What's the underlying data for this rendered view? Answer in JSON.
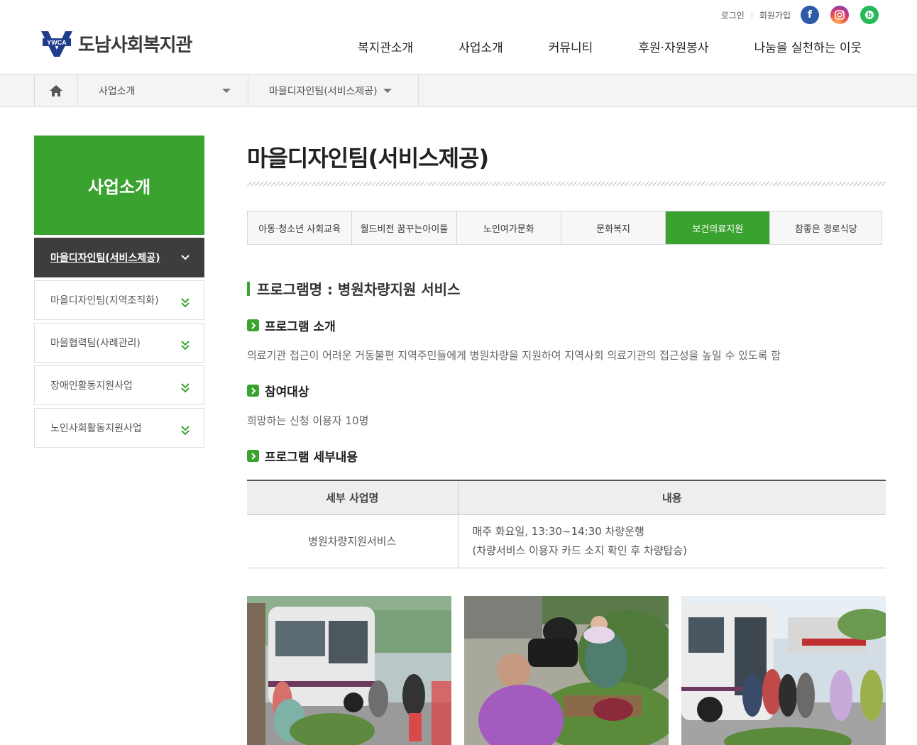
{
  "header": {
    "logo_badge": "YWCA",
    "logo_text": "도남사회복지관",
    "util": {
      "login": "로그인",
      "join": "회원가입"
    },
    "sns": [
      "facebook-icon",
      "instagram-icon",
      "blog-icon"
    ],
    "gnb": [
      "복지관소개",
      "사업소개",
      "커뮤니티",
      "후원·자원봉사",
      "나눔을 실천하는 이웃"
    ]
  },
  "location": {
    "depth1": "사업소개",
    "depth2": "마을디자인팀(서비스제공)"
  },
  "sidebar": {
    "title": "사업소개",
    "items": [
      {
        "label": "마을디자인팀(서비스제공)",
        "active": true
      },
      {
        "label": "마을디자인팀(지역조직화)",
        "active": false
      },
      {
        "label": "마을협력팀(사례관리)",
        "active": false
      },
      {
        "label": "장애인활동지원사업",
        "active": false
      },
      {
        "label": "노인사회활동지원사업",
        "active": false
      }
    ]
  },
  "main": {
    "title": "마을디자인팀(서비스제공)",
    "tabs": [
      {
        "label": "아동·청소년 사회교육",
        "active": false
      },
      {
        "label": "월드비전 꿈꾸는아이들",
        "active": false
      },
      {
        "label": "노인여가문화",
        "active": false
      },
      {
        "label": "문화복지",
        "active": false
      },
      {
        "label": "보건의료지원",
        "active": true
      },
      {
        "label": "참좋은 경로식당",
        "active": false
      }
    ],
    "program_title": "프로그램명 : 병원차량지원 서비스",
    "intro_heading": "프로그램 소개",
    "intro_text": "의료기관 접근이 어려운 거동불편 지역주민들에게 병원차량을 지원하여 지역사회 의료기관의 접근성을 높일 수 있도록 함",
    "target_heading": "참여대상",
    "target_text": "희망하는 신청 이용자 10명",
    "detail_heading": "프로그램 세부내용",
    "table": {
      "headers": [
        "세부 사업명",
        "내용"
      ],
      "rows": [
        {
          "name": "병원차량지원서비스",
          "line1": "매주 화요일, 13:30~14:30 차량운행",
          "line2": "(차량서비스 이용자 카드 소지 확인 후 차량탑승)"
        }
      ]
    }
  },
  "colors": {
    "accent": "#3aa22f",
    "dark": "#3d3d3d",
    "facebook": "#2d5aa8",
    "blog": "#27b85a"
  }
}
